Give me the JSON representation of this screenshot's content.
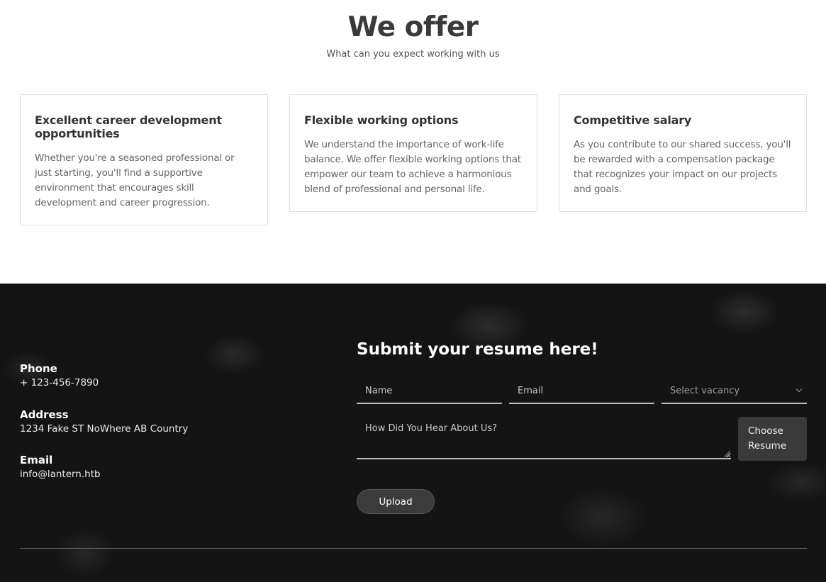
{
  "offer": {
    "title": "We offer",
    "subtitle": "What can you expect working with us",
    "cards": [
      {
        "title": "Excellent career development opportunities",
        "text": "Whether you're a seasoned professional or just starting, you'll find a supportive environment that encourages skill development and career progression."
      },
      {
        "title": "Flexible working options",
        "text": "We understand the importance of work-life balance. We offer flexible working options that empower our team to achieve a harmonious blend of professional and personal life."
      },
      {
        "title": "Competitive salary",
        "text": "As you contribute to our shared success, you'll be rewarded with a compensation package that recognizes your impact on our projects and goals."
      }
    ]
  },
  "contact": {
    "phone_label": "Phone",
    "phone_value": "+ 123-456-7890",
    "address_label": "Address",
    "address_value": "1234 Fake ST NoWhere AB Country",
    "email_label": "Email",
    "email_value": "info@lantern.htb"
  },
  "form": {
    "title": "Submit your resume here!",
    "name_placeholder": "Name",
    "email_placeholder": "Email",
    "vacancy_selected": "Select vacancy",
    "message_placeholder": "How Did You Hear About Us?",
    "choose_resume_label": "Choose Resume",
    "upload_label": "Upload"
  },
  "colors": {
    "footer_bg": "#141414",
    "button_bg": "#3b3b3b",
    "text_dark": "#333333"
  }
}
